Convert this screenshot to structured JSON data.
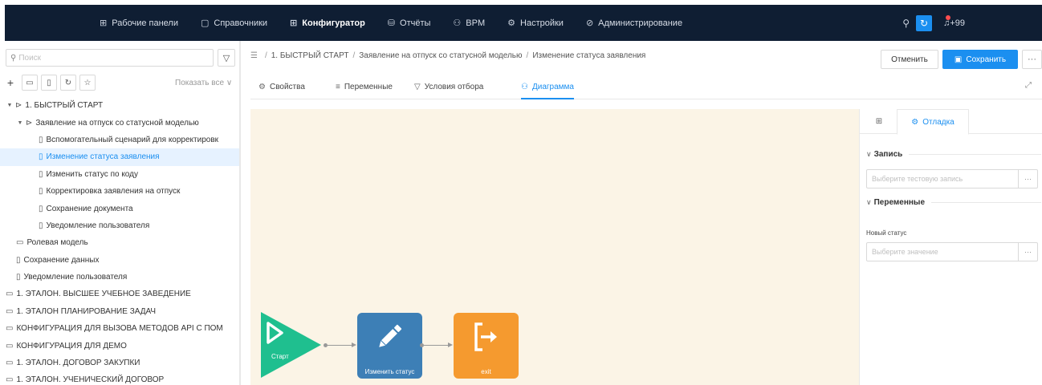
{
  "topnav": {
    "items": [
      {
        "icon": "dashboard-icon",
        "glyph": "⊞",
        "label": "Рабочие панели"
      },
      {
        "icon": "document-icon",
        "glyph": "▢",
        "label": "Справочники"
      },
      {
        "icon": "configurator-icon",
        "glyph": "⊞",
        "label": "Конфигуратор"
      },
      {
        "icon": "reports-icon",
        "glyph": "⛁",
        "label": "Отчёты"
      },
      {
        "icon": "bpm-icon",
        "glyph": "⚇",
        "label": "BPM"
      },
      {
        "icon": "settings-icon",
        "glyph": "⚙",
        "label": "Настройки"
      },
      {
        "icon": "admin-icon",
        "glyph": "⊘",
        "label": "Администрирование"
      }
    ],
    "active_index": 2,
    "notifications": "+99"
  },
  "sidebar": {
    "search_placeholder": "Поиск",
    "show_all": "Показать все ∨",
    "tree": [
      {
        "label": "1. БЫСТРЫЙ СТАРТ",
        "depth": 0,
        "arrow": "▼",
        "icon": "folder-open-icon",
        "selected": false
      },
      {
        "label": "Заявление на отпуск со статусной моделью",
        "depth": 1,
        "arrow": "▼",
        "icon": "folder-open-icon",
        "selected": false
      },
      {
        "label": "Вспомогательный сценарий для корректировк",
        "depth": 2,
        "arrow": "",
        "icon": "file-icon",
        "selected": false
      },
      {
        "label": "Изменение статуса заявления",
        "depth": 2,
        "arrow": "",
        "icon": "file-icon",
        "selected": true
      },
      {
        "label": "Изменить статус по коду",
        "depth": 2,
        "arrow": "",
        "icon": "file-icon",
        "selected": false
      },
      {
        "label": "Корректировка заявления на отпуск",
        "depth": 2,
        "arrow": "",
        "icon": "file-icon",
        "selected": false
      },
      {
        "label": "Сохранение документа",
        "depth": 2,
        "arrow": "",
        "icon": "file-icon",
        "selected": false
      },
      {
        "label": "Уведомление пользователя",
        "depth": 2,
        "arrow": "",
        "icon": "file-icon",
        "selected": false
      },
      {
        "label": "Ролевая модель",
        "depth": 1,
        "arrow": "",
        "icon": "folder-icon",
        "selected": false
      },
      {
        "label": "Сохранение данных",
        "depth": 1,
        "arrow": "",
        "icon": "file-icon",
        "selected": false
      },
      {
        "label": "Уведомление пользователя",
        "depth": 1,
        "arrow": "",
        "icon": "file-icon",
        "selected": false
      },
      {
        "label": "1. ЭТАЛОН. ВЫСШЕЕ УЧЕБНОЕ ЗАВЕДЕНИЕ",
        "depth": 0,
        "arrow": "",
        "icon": "folder-icon",
        "selected": false
      },
      {
        "label": "1. ЭТАЛОН ПЛАНИРОВАНИЕ ЗАДАЧ",
        "depth": 0,
        "arrow": "",
        "icon": "folder-icon",
        "selected": false
      },
      {
        "label": "КОНФИГУРАЦИЯ ДЛЯ ВЫЗОВА МЕТОДОВ API С ПОМ",
        "depth": 0,
        "arrow": "",
        "icon": "folder-icon",
        "selected": false
      },
      {
        "label": "КОНФИГУРАЦИЯ ДЛЯ ДЕМО",
        "depth": 0,
        "arrow": "",
        "icon": "folder-icon",
        "selected": false
      },
      {
        "label": "1. ЭТАЛОН. ДОГОВОР ЗАКУПКИ",
        "depth": 0,
        "arrow": "",
        "icon": "folder-icon",
        "selected": false
      },
      {
        "label": "1. ЭТАЛОН. УЧЕНИЧЕСКИЙ ДОГОВОР",
        "depth": 0,
        "arrow": "",
        "icon": "folder-icon",
        "selected": false
      }
    ]
  },
  "breadcrumb": [
    "1. БЫСТРЫЙ СТАРТ",
    "Заявление на отпуск со статусной моделью",
    "Изменение статуса заявления"
  ],
  "actions": {
    "cancel": "Отменить",
    "save": "Сохранить",
    "more": "···"
  },
  "tabs": [
    {
      "icon": "gear-icon",
      "glyph": "⚙",
      "label": "Свойства"
    },
    {
      "icon": "list-icon",
      "glyph": "≡",
      "label": "Переменные"
    },
    {
      "icon": "filter-icon",
      "glyph": "▽",
      "label": "Условия отбора"
    },
    {
      "icon": "diagram-icon",
      "glyph": "⚇",
      "label": "Диаграмма"
    }
  ],
  "active_tab": 3,
  "diagram": {
    "start_label": "Старт",
    "change_label": "Изменить статус",
    "exit_label": "exit",
    "start_color": "#1fbf8f",
    "change_color": "#3d7fb6",
    "exit_color": "#f59a2f",
    "canvas_color": "#fbf4e6"
  },
  "debug_panel": {
    "tab_label": "Отладка",
    "record_section": "Запись",
    "record_placeholder": "Выберите тестовую запись",
    "variables_section": "Переменные",
    "new_status_label": "Новый статус",
    "new_status_placeholder": "Выберите значение"
  },
  "colors": {
    "accent": "#1b8ff0",
    "topbar": "#0f1e33"
  }
}
